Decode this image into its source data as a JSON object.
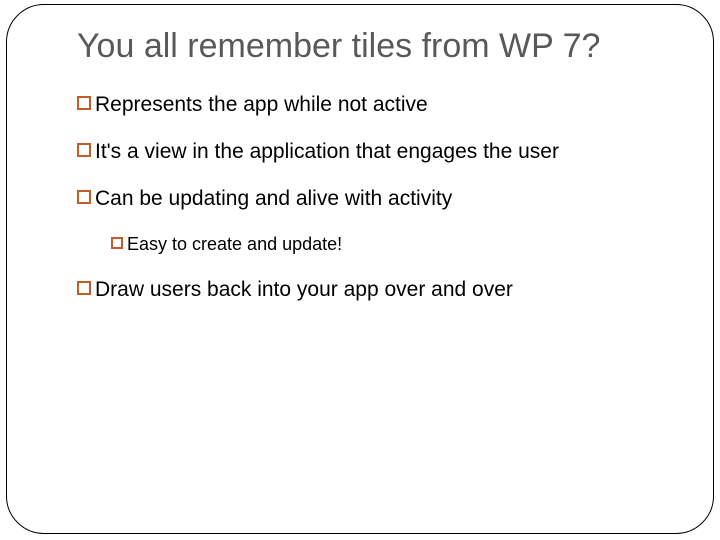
{
  "slide": {
    "title": "You all remember tiles from WP 7?",
    "bullets": [
      {
        "text": "Represents the app while not active",
        "level": 0
      },
      {
        "text": "It's a view in the application that engages the user",
        "level": 0
      },
      {
        "text": "Can be updating and alive with activity",
        "level": 0
      },
      {
        "text": "Easy to create and update!",
        "level": 1
      },
      {
        "text": "Draw users back into your app over and over",
        "level": 0
      }
    ]
  },
  "colors": {
    "bullet_accent": "#c55b28",
    "title_color": "#595959"
  }
}
